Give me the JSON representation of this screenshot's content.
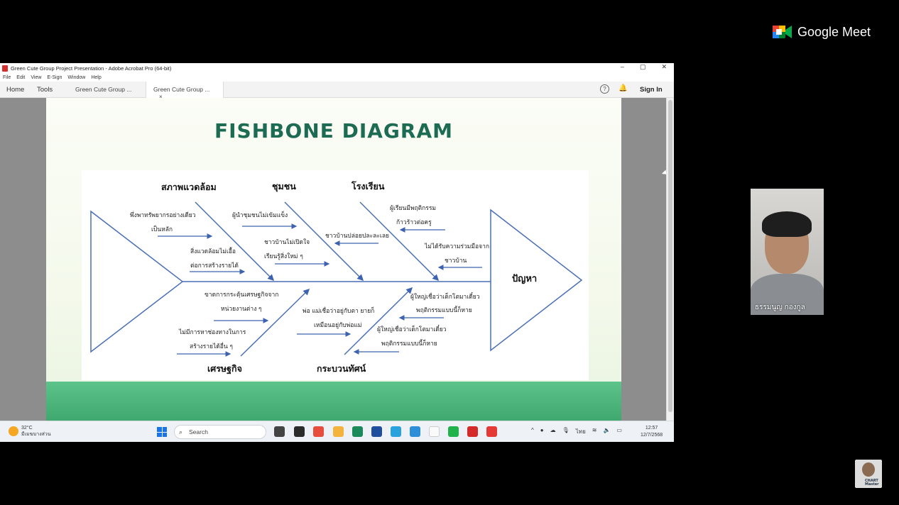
{
  "meet": {
    "brand": "Google Meet"
  },
  "window": {
    "title": "Green Cute Group Project Presentation - Adobe Acrobat Pro (64-bit)",
    "controls": {
      "minimize": "–",
      "restore": "▢",
      "close": "✕"
    }
  },
  "menu": {
    "items": [
      "File",
      "Edit",
      "View",
      "E-Sign",
      "Window",
      "Help"
    ]
  },
  "tabs": {
    "home": "Home",
    "tools": "Tools",
    "doc_tab_1": "Green Cute Group ...",
    "doc_tab_2": "Green Cute Group ...",
    "close": "×",
    "help": "?",
    "sign_in": "Sign In"
  },
  "slide": {
    "title": "FISHBONE DIAGRAM",
    "head_label": "ปัญหา",
    "categories": {
      "top_1": "สภาพแวดล้อม",
      "top_2": "ชุมชน",
      "top_3": "โรงเรียน",
      "bottom_1": "เศรษฐกิจ",
      "bottom_2": "กระบวนทัศน์"
    },
    "causes": {
      "env_1a": "พึ่งพาทรัพยากรอย่างเดียว",
      "env_1b": "เป็นหลัก",
      "env_2a": "สิ่งแวดล้อมไม่เอื้อ",
      "env_2b": "ต่อการสร้างรายได้",
      "com_1": "ผู้นำชุมชนไม่เข้มแข็ง",
      "com_2a": "ชาวบ้านไม่เปิดใจ",
      "com_2b": "เรียนรู้สิ่งใหม่ ๆ",
      "sch_1a": "ผู้เรียนมีพฤติกรรม",
      "sch_1b": "ก้าวร้าวต่อครู",
      "sch_2": "ชาวบ้านปล่อยปละละเลย",
      "sch_3a": "ไม่ได้รับความร่วมมือจาก",
      "sch_3b": "ชาวบ้าน",
      "eco_1a": "ขาดการกระตุ้นเศรษฐกิจจาก",
      "eco_1b": "หน่วยงานต่าง ๆ",
      "eco_2a": "ไม่มีการหาช่องทางในการ",
      "eco_2b": "สร้างรายได้อื่น ๆ",
      "par_1a": "พ่อ แม่เชื่อว่าอยู่กับตา ยายก็",
      "par_1b": "เหมือนอยู่กับพ่อแม่",
      "par_2a": "ผู้ใหญ่เชื่อว่าเด็กโตมาเดี๋ยว",
      "par_2b": "พฤติกรรมแบบนี้ก็หาย",
      "par_3a": "ผู้ใหญ่เชื่อว่าเด็กโตมาเดี๋ยว",
      "par_3b": "พฤติกรรมแบบนี้ก็หาย"
    }
  },
  "taskbar": {
    "weather_temp": "32°C",
    "weather_desc": "มีเมฆบางส่วน",
    "search": "Search",
    "tray_lang": "ไทย",
    "tray_up": "^",
    "time": "12:57",
    "date": "12/7/2568"
  },
  "participant": {
    "name": "ธรรมนูญ กองกูล"
  },
  "self": {
    "label_1": "CHART",
    "label_2": "Master"
  },
  "colors": {
    "title_green": "#1d6b53",
    "line_blue": "#4a6fb5",
    "arrow_blue": "#3d63b0"
  }
}
